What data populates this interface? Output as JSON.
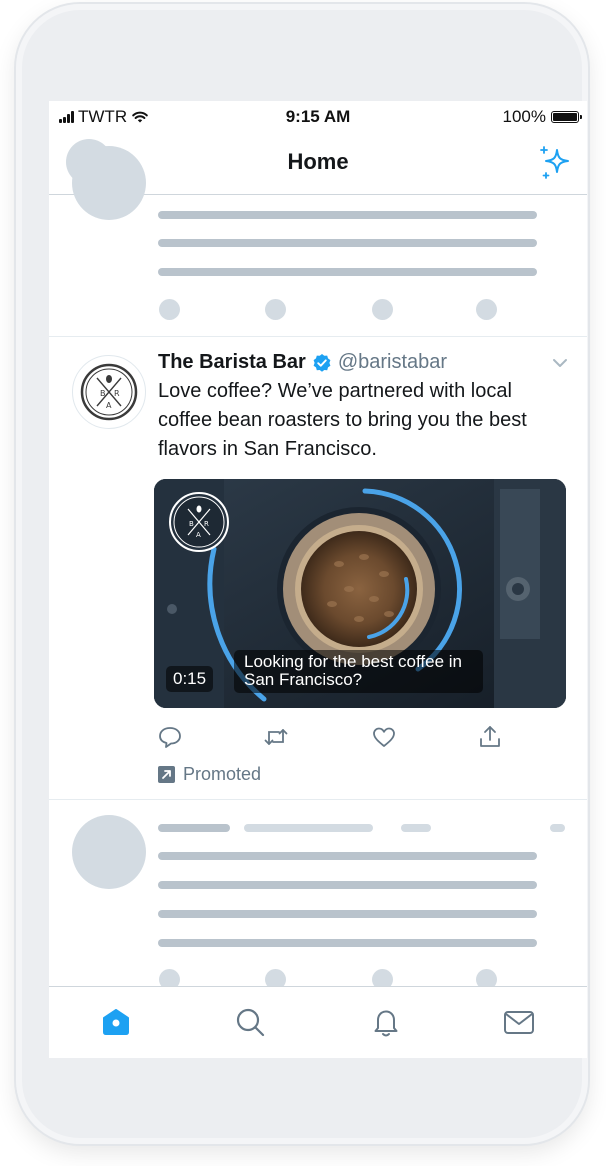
{
  "status_bar": {
    "carrier": "TWTR",
    "time": "9:15 AM",
    "battery": "100%"
  },
  "nav": {
    "title": "Home",
    "sparkle_icon": "sparkle-icon"
  },
  "tweet": {
    "name": "The Barista Bar",
    "handle": "@baristabar",
    "verified": true,
    "text": "Love coffee? We’ve partnered with local coffee bean roasters to bring you the best flavors in San Francisco.",
    "logo_text": "B A R A",
    "media": {
      "duration": "0:15",
      "caption": "Looking for the best coffee in San Francisco?"
    },
    "actions": [
      "reply-icon",
      "retweet-icon",
      "like-icon",
      "share-icon"
    ],
    "promoted_label": "Promoted"
  },
  "tab_bar": {
    "tabs": [
      "home-icon",
      "search-icon",
      "notifications-icon",
      "messages-icon"
    ],
    "active": "home-icon"
  },
  "colors": {
    "accent": "#1da1f2",
    "text": "#14171a",
    "secondary": "#657786",
    "skeleton": "#d3dbe2",
    "skeleton_dark": "#b9c3cc"
  }
}
